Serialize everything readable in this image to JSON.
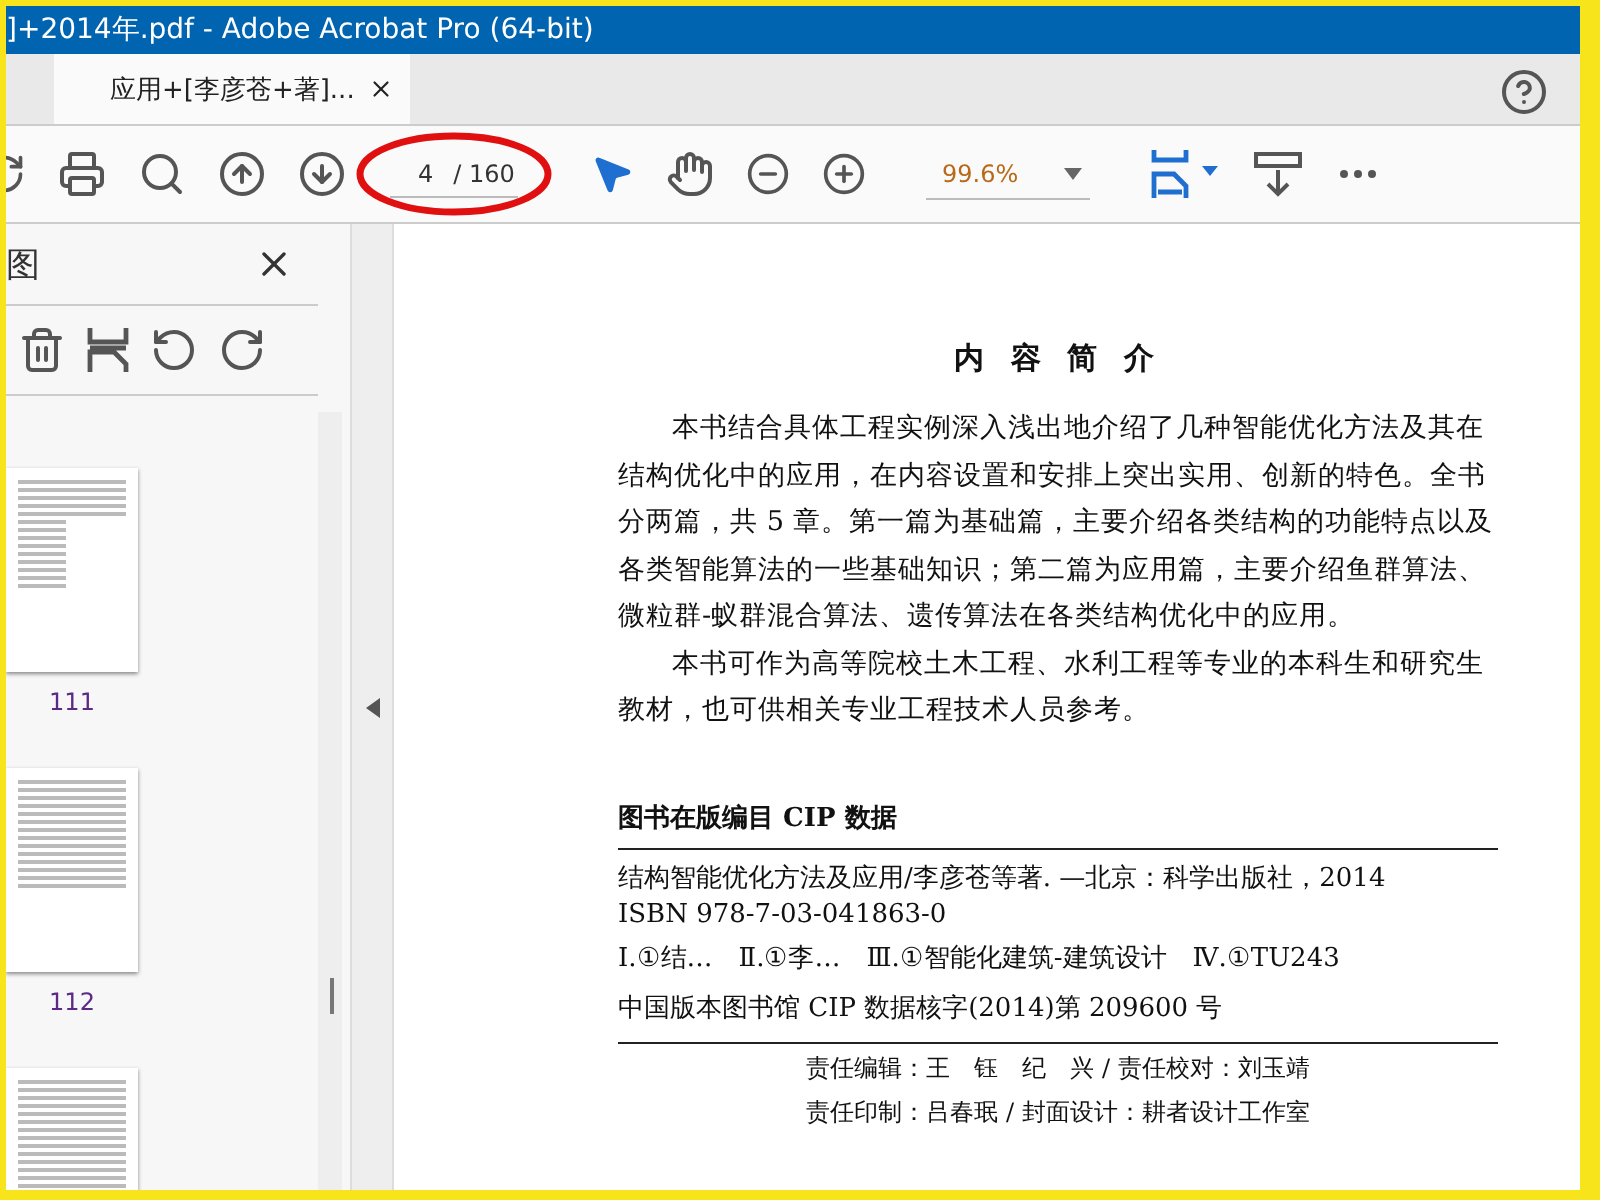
{
  "window": {
    "title": "]+2014年.pdf - Adobe Acrobat Pro (64-bit)"
  },
  "tabs": [
    {
      "label": "应用+[李彦苍+著]...",
      "selected": true
    }
  ],
  "toolbar": {
    "page_input": "4",
    "page_total": "/ 160",
    "zoom": "99.6%"
  },
  "sidebar": {
    "title": "图",
    "thumbnails": [
      {
        "label": "111",
        "kind": "figure"
      },
      {
        "label": "112",
        "kind": "table"
      },
      {
        "kind": "table"
      }
    ]
  },
  "document": {
    "heading": "内 容 简 介",
    "paragraphs": [
      "本书结合具体工程实例深入浅出地介绍了几种智能优化方法及其在结构优化中的应用，在内容设置和安排上突出实用、创新的特色。全书分两篇，共 5 章。第一篇为基础篇，主要介绍各类结构的功能特点以及各类智能算法的一些基础知识；第二篇为应用篇，主要介绍鱼群算法、微粒群-蚁群混合算法、遗传算法在各类结构优化中的应用。",
      "本书可作为高等院校土木工程、水利工程等专业的本科生和研究生教材，也可供相关专业工程技术人员参考。"
    ],
    "cip_title": "图书在版编目 CIP 数据",
    "cip_lines": [
      "结构智能优化方法及应用/李彦苍等著. —北京：科学出版社，2014",
      "ISBN 978-7-03-041863-0"
    ],
    "cip_class": "Ⅰ.①结…　Ⅱ.①李…　Ⅲ.①智能化建筑-建筑设计　Ⅳ.①TU243",
    "cip_number": "中国版本图书馆 CIP 数据核字(2014)第 209600 号",
    "credits": [
      "责任编辑：王　钰　纪　兴 / 责任校对：刘玉靖",
      "责任印制：吕春珉 / 封面设计：耕者设计工作室"
    ]
  }
}
